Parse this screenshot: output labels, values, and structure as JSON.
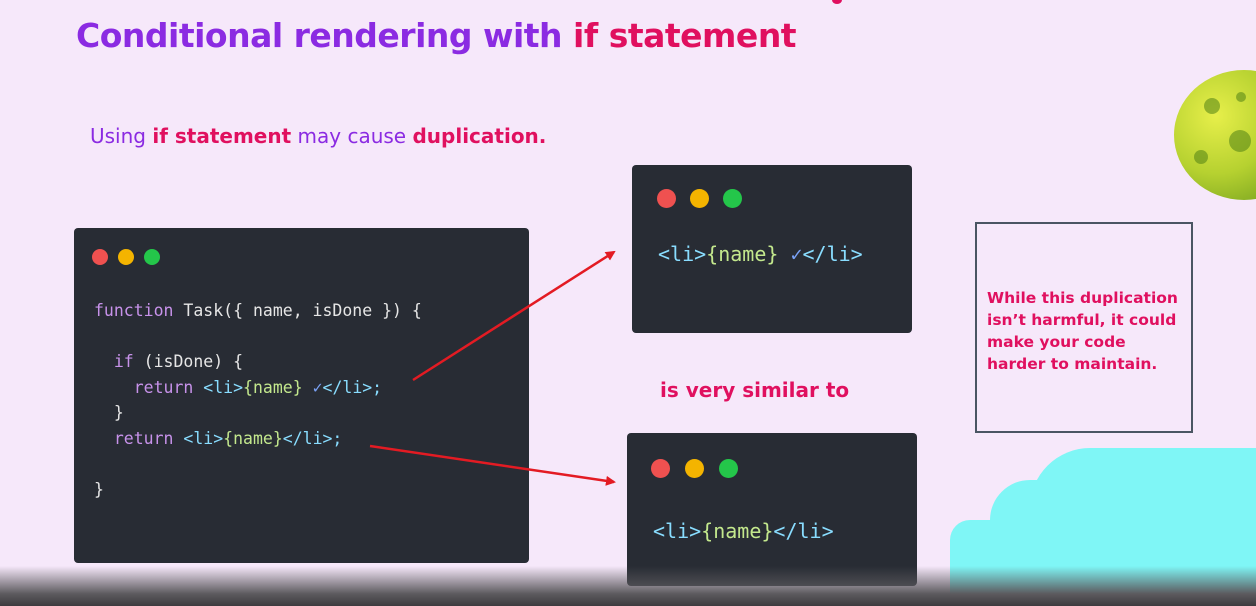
{
  "slide": {
    "title_prefix": "Conditional rendering with ",
    "title_highlight": "if statement",
    "subtitle": {
      "p1": "Using ",
      "hl1": "if statement",
      "p2": " may cause ",
      "hl2": "duplication",
      "p3": "."
    },
    "similar_label": "is very similar to",
    "note": "While this duplication isn’t harmful, it could make your code harder to maintain."
  },
  "code_main": {
    "l1_kw": "function",
    "l1_rest": " Task({ name, isDone }) {",
    "l3_kw": "if",
    "l3_rest": " (isDone) {",
    "l4_kw": "return",
    "l4_open": " <li>",
    "l4_expr": "{name}",
    "l4_check": " ✓",
    "l4_close": "</li>;",
    "l5": "}",
    "l6_kw": "return",
    "l6_open": " <li>",
    "l6_expr": "{name}",
    "l6_close": "</li>;",
    "l8": "}"
  },
  "code_top": {
    "open": "<li>",
    "expr": "{name}",
    "check": " ✓",
    "close": "</li>"
  },
  "code_bottom": {
    "open": "<li>",
    "expr": "{name}",
    "close": "</li>"
  },
  "colors": {
    "title": "#8b2be2",
    "highlight": "#e0105f",
    "editor_bg": "#282c34",
    "arrow": "#e31b23"
  },
  "icons": [
    "window-close-dot-icon",
    "window-minimize-dot-icon",
    "window-maximize-dot-icon",
    "arrow-icon",
    "planet-icon"
  ]
}
